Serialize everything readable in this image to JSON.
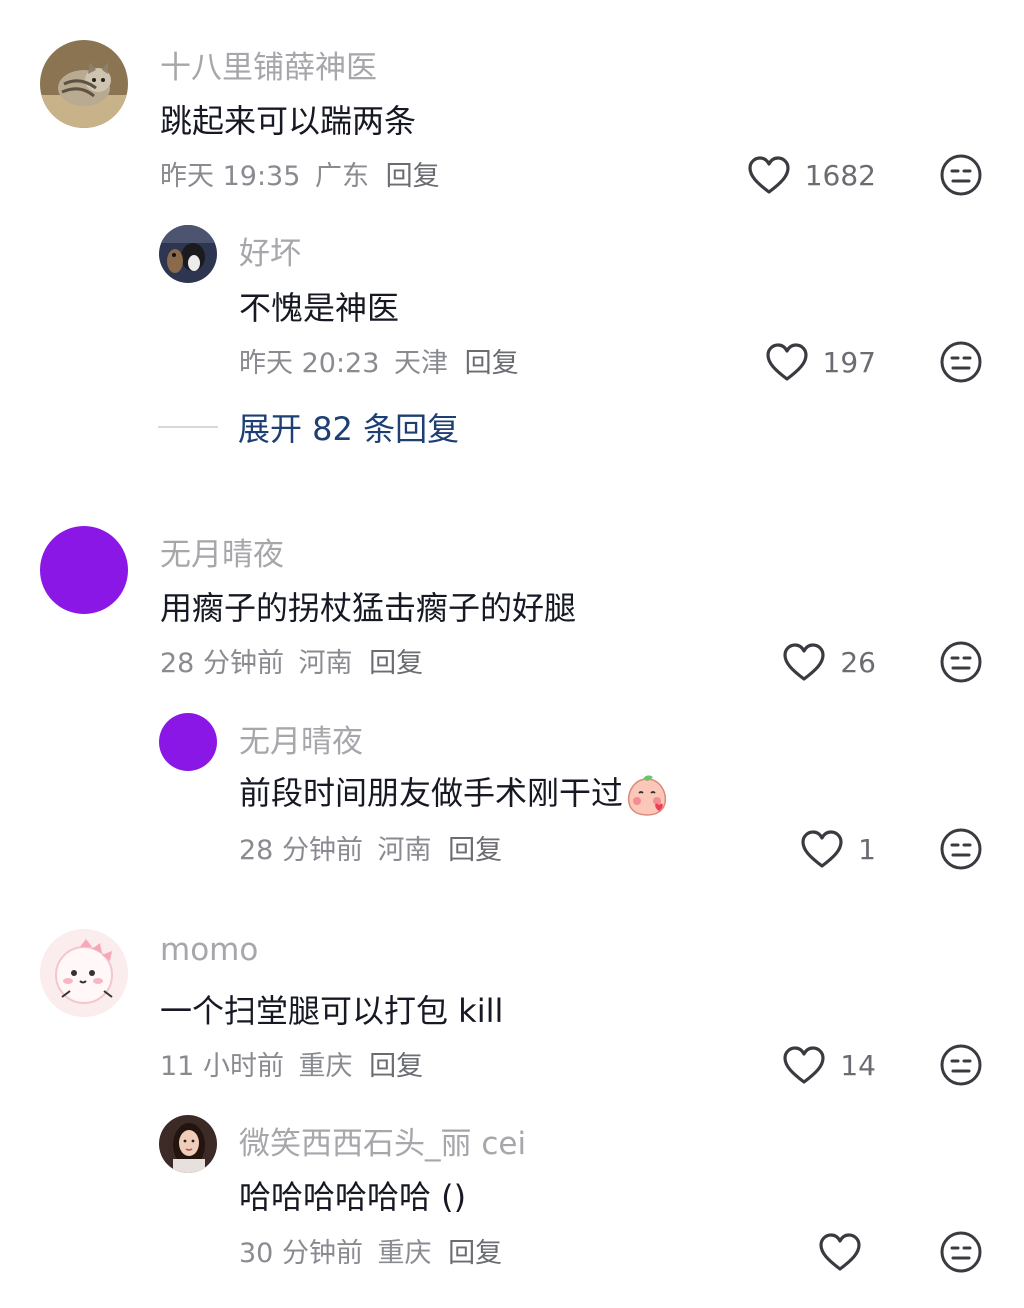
{
  "comments": [
    {
      "username": "十八里铺薛神医",
      "text": "跳起来可以踹两条",
      "time": "昨天 19:35",
      "location": "广东",
      "reply_label": "回复",
      "likes": "1682",
      "avatar_icon": "cat-avatar"
    },
    {
      "username": "好坏",
      "text": "不愧是神医",
      "time": "昨天 20:23",
      "location": "天津",
      "reply_label": "回复",
      "likes": "197",
      "avatar_icon": "dog-avatar"
    },
    {
      "username": "无月晴夜",
      "text": "用瘸子的拐杖猛击瘸子的好腿",
      "time": "28 分钟前",
      "location": "河南",
      "reply_label": "回复",
      "likes": "26",
      "avatar_color": "#8b17e6"
    },
    {
      "username": "无月晴夜",
      "text": "前段时间朋友做手术刚干过",
      "time": "28 分钟前",
      "location": "河南",
      "reply_label": "回复",
      "likes": "1",
      "avatar_color": "#8b17e6",
      "sticker_icon": "peach-blush-sticker-icon"
    },
    {
      "username": "momo",
      "text": "一个扫堂腿可以打包 kill",
      "time": "11 小时前",
      "location": "重庆",
      "reply_label": "回复",
      "likes": "14",
      "avatar_icon": "pink-dino-avatar"
    },
    {
      "username": "微笑西西石头_丽 cei",
      "text": "哈哈哈哈哈哈 ()",
      "time": "30 分钟前",
      "location": "重庆",
      "reply_label": "回复",
      "likes": "",
      "avatar_icon": "girl-photo-avatar"
    }
  ],
  "expand_replies": "展开 82 条回复",
  "colors": {
    "username": "#a6a6ab",
    "text": "#161823",
    "meta": "#8a8b91",
    "expand_link": "#1e3f74"
  }
}
